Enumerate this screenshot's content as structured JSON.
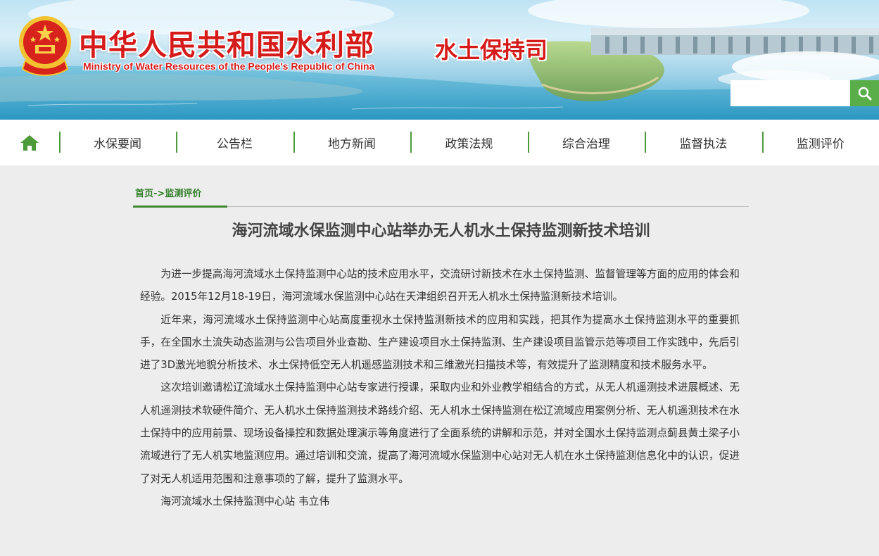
{
  "header": {
    "title_cn": "中华人民共和国水利部",
    "title_en": "Ministry of Water Resources of the People's Republic of China",
    "department": "水土保持司",
    "search": {
      "value": "",
      "placeholder": ""
    }
  },
  "nav": {
    "home_icon": "home-icon",
    "items": [
      {
        "label": "水保要闻"
      },
      {
        "label": "公告栏"
      },
      {
        "label": "地方新闻"
      },
      {
        "label": "政策法规"
      },
      {
        "label": "综合治理"
      },
      {
        "label": "监督执法"
      },
      {
        "label": "监测评价"
      }
    ]
  },
  "breadcrumb": {
    "home": "首页",
    "separator": "->",
    "current": "监测评价"
  },
  "article": {
    "title": "海河流域水保监测中心站举办无人机水土保持监测新技术培训",
    "paragraphs": [
      "为进一步提高海河流域水土保持监测中心站的技术应用水平，交流研讨新技术在水土保持监测、监督管理等方面的应用的体会和经验。2015年12月18-19日，海河流域水保监测中心站在天津组织召开无人机水土保持监测新技术培训。",
      "近年来，海河流域水土保持监测中心站高度重视水土保持监测新技术的应用和实践，把其作为提高水土保持监测水平的重要抓手，在全国水土流失动态监测与公告项目外业查勘、生产建设项目水土保持监测、生产建设项目监管示范等项目工作实践中，先后引进了3D激光地貌分析技术、水土保持低空无人机遥感监测技术和三维激光扫描技术等，有效提升了监测精度和技术服务水平。",
      "这次培训邀请松辽流域水土保持监测中心站专家进行授课，采取内业和外业教学相结合的方式，从无人机遥测技术进展概述、无人机遥测技术软硬件简介、无人机水土保持监测技术路线介绍、无人机水土保持监测在松辽流域应用案例分析、无人机遥测技术在水土保持中的应用前景、现场设备操控和数据处理演示等角度进行了全面系统的讲解和示范，并对全国水土保持监测点蓟县黄土梁子小流域进行了无人机实地监测应用。通过培训和交流，提高了海河流域水保监测中心站对无人机在水土保持监测信息化中的认识，促进了对无人机适用范围和注意事项的了解，提升了监测水平。",
      "海河流域水土保持监测中心站 韦立伟"
    ]
  },
  "colors": {
    "accent_green": "#4d9a3b",
    "title_red": "#d51a1a",
    "search_button": "#5aae4a"
  }
}
